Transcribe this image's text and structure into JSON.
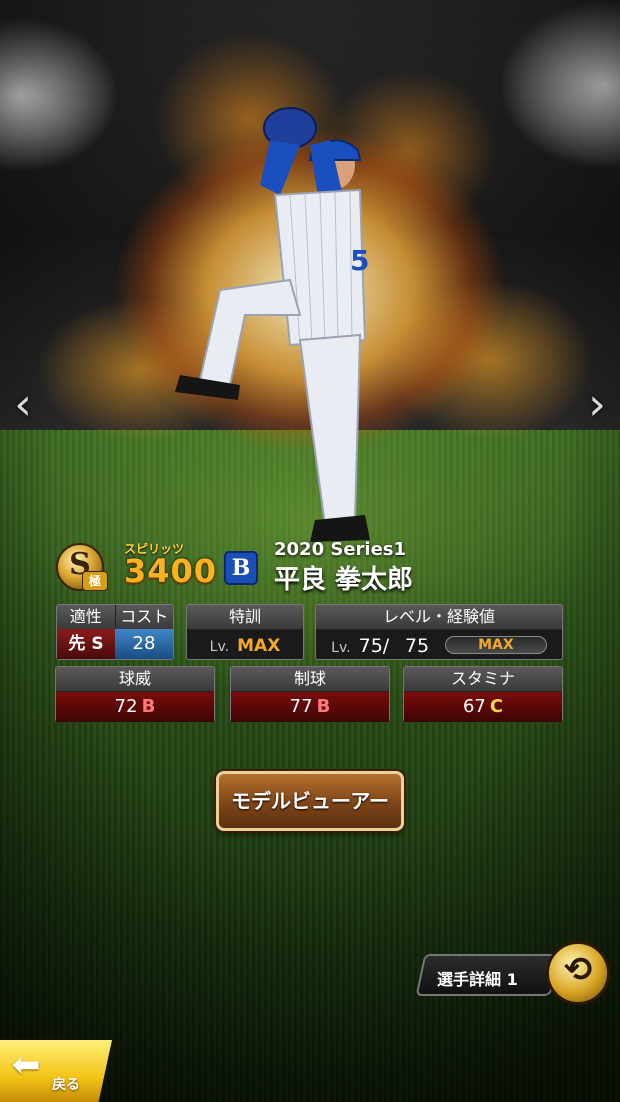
{
  "card": {
    "spirits_label": "スピリッツ",
    "spirits_value": "3400",
    "rank_letter": "S",
    "rank_sub": "極",
    "team_logo": "B",
    "series": "2020 Series1",
    "player_name": "平良 拳太郎"
  },
  "aptitude": {
    "header": "適性",
    "value": "先 S",
    "cost_header": "コスト",
    "cost_value": "28"
  },
  "training": {
    "header": "特訓",
    "lv_prefix": "Lv.",
    "value": "MAX"
  },
  "level": {
    "header": "レベル・経験値",
    "lv_prefix": "Lv.",
    "current": "75/",
    "max": "75",
    "xp_label": "MAX",
    "xp_progress": 1.0
  },
  "stats": [
    {
      "label": "球威",
      "value": "72",
      "grade": "B"
    },
    {
      "label": "制球",
      "value": "77",
      "grade": "B"
    },
    {
      "label": "スタミナ",
      "value": "67",
      "grade": "C"
    }
  ],
  "buttons": {
    "model_viewer": "モデルビューアー",
    "player_detail": "選手詳細 1",
    "back": "戻る"
  },
  "icons": {
    "prev": "chevron-left-icon",
    "next": "chevron-right-icon",
    "swap": "swap-arrows-icon",
    "back": "back-arrow-icon"
  },
  "colors": {
    "spirits": "#ffb21f",
    "max": "#f3a82a",
    "stat_bg": "#7a0c0c",
    "grade_b": "#ff7a7a",
    "grade_c": "#ffd447"
  }
}
